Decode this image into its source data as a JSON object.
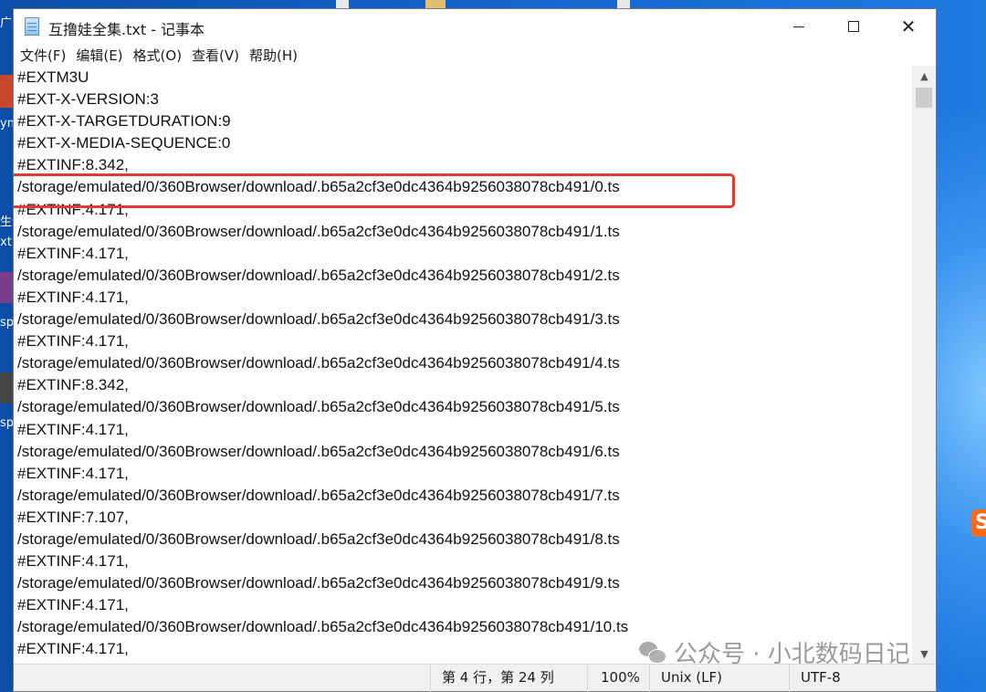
{
  "window": {
    "title": "互撸娃全集.txt - 记事本",
    "controls": {
      "minimize": "minimize",
      "maximize": "maximize",
      "close": "✕"
    }
  },
  "menu": [
    {
      "label": "文件(F)"
    },
    {
      "label": "编辑(E)"
    },
    {
      "label": "格式(O)"
    },
    {
      "label": "查看(V)"
    },
    {
      "label": "帮助(H)"
    }
  ],
  "editor": {
    "lines": [
      "#EXTM3U",
      "#EXT-X-VERSION:3",
      "#EXT-X-TARGETDURATION:9",
      "#EXT-X-MEDIA-SEQUENCE:0",
      "#EXTINF:8.342,",
      "/storage/emulated/0/360Browser/download/.b65a2cf3e0dc4364b9256038078cb491/0.ts",
      "#EXTINF:4.171,",
      "/storage/emulated/0/360Browser/download/.b65a2cf3e0dc4364b9256038078cb491/1.ts",
      "#EXTINF:4.171,",
      "/storage/emulated/0/360Browser/download/.b65a2cf3e0dc4364b9256038078cb491/2.ts",
      "#EXTINF:4.171,",
      "/storage/emulated/0/360Browser/download/.b65a2cf3e0dc4364b9256038078cb491/3.ts",
      "#EXTINF:4.171,",
      "/storage/emulated/0/360Browser/download/.b65a2cf3e0dc4364b9256038078cb491/4.ts",
      "#EXTINF:8.342,",
      "/storage/emulated/0/360Browser/download/.b65a2cf3e0dc4364b9256038078cb491/5.ts",
      "#EXTINF:4.171,",
      "/storage/emulated/0/360Browser/download/.b65a2cf3e0dc4364b9256038078cb491/6.ts",
      "#EXTINF:4.171,",
      "/storage/emulated/0/360Browser/download/.b65a2cf3e0dc4364b9256038078cb491/7.ts",
      "#EXTINF:7.107,",
      "/storage/emulated/0/360Browser/download/.b65a2cf3e0dc4364b9256038078cb491/8.ts",
      "#EXTINF:4.171,",
      "/storage/emulated/0/360Browser/download/.b65a2cf3e0dc4364b9256038078cb491/9.ts",
      "#EXTINF:4.171,",
      "/storage/emulated/0/360Browser/download/.b65a2cf3e0dc4364b9256038078cb491/10.ts",
      "#EXTINF:4.171,"
    ],
    "highlight_color": "#e03a35"
  },
  "status": {
    "position": "第 4 行，第 24 列",
    "zoom": "100%",
    "line_ending": "Unix (LF)",
    "encoding": "UTF-8"
  },
  "watermark": {
    "text": "公众号 · 小北数码日记"
  },
  "desktop": {
    "labels": [
      "广",
      "yn",
      "生全",
      "xt",
      "sp",
      "sp"
    ],
    "sogou_badge": "S"
  }
}
